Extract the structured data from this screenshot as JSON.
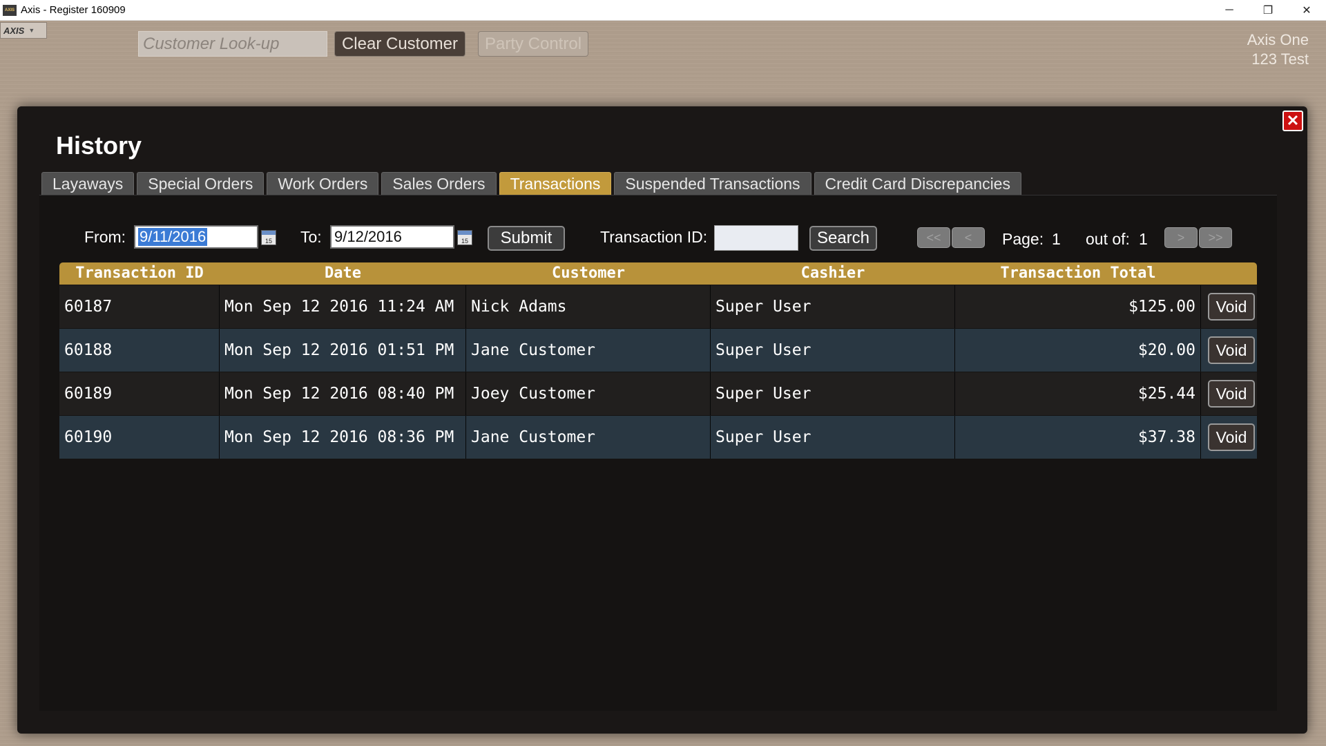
{
  "window": {
    "title": "Axis - Register  160909",
    "app_icon": "AXIS",
    "minimize_icon": "─",
    "restore_icon": "❐",
    "close_icon": "✕"
  },
  "background": {
    "axis_menu": "AXIS",
    "customer_lookup_placeholder": "Customer Look-up",
    "clear_customer_label": "Clear Customer",
    "party_control_label": "Party Control",
    "store_name": "Axis One",
    "store_sub": "123 Test"
  },
  "modal": {
    "title": "History",
    "close_icon": "✕",
    "tabs": [
      {
        "label": "Layaways",
        "active": false
      },
      {
        "label": "Special Orders",
        "active": false
      },
      {
        "label": "Work Orders",
        "active": false
      },
      {
        "label": "Sales Orders",
        "active": false
      },
      {
        "label": "Transactions",
        "active": true
      },
      {
        "label": "Suspended Transactions",
        "active": false
      },
      {
        "label": "Credit Card Discrepancies",
        "active": false
      }
    ],
    "filters": {
      "from_label": "From:",
      "from_value": "9/11/2016",
      "to_label": "To:",
      "to_value": "9/12/2016",
      "submit_label": "Submit",
      "transaction_id_label": "Transaction ID:",
      "transaction_id_value": "",
      "search_label": "Search",
      "calendar_icon_text": "15"
    },
    "pagination": {
      "first": "<<",
      "prev": "<",
      "page_label": "Page:",
      "page": "1",
      "out_of_label": "out of:",
      "total": "1",
      "next": ">",
      "last": ">>"
    },
    "table": {
      "columns": [
        "Transaction ID",
        "Date",
        "Customer",
        "Cashier",
        "Transaction Total"
      ],
      "void_label": "Void",
      "rows": [
        {
          "id": "60187",
          "date": "Mon Sep 12 2016 11:24 AM",
          "customer": "Nick Adams",
          "cashier": "Super User",
          "total": "$125.00"
        },
        {
          "id": "60188",
          "date": "Mon Sep 12 2016 01:51 PM",
          "customer": "Jane Customer",
          "cashier": "Super User",
          "total": "$20.00"
        },
        {
          "id": "60189",
          "date": "Mon Sep 12 2016 08:40 PM",
          "customer": "Joey Customer",
          "cashier": "Super User",
          "total": "$25.44"
        },
        {
          "id": "60190",
          "date": "Mon Sep 12 2016 08:36 PM",
          "customer": "Jane Customer",
          "cashier": "Super User",
          "total": "$37.38"
        }
      ]
    }
  },
  "colors": {
    "accent_gold": "#c29a3c",
    "header_gold": "#b8923a",
    "close_red": "#cc1111"
  }
}
